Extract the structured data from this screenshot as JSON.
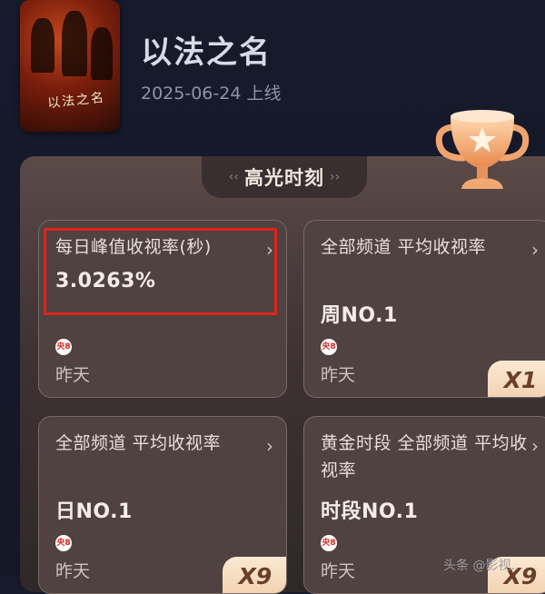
{
  "show": {
    "title": "以法之名",
    "release_date": "2025-06-24 上线",
    "poster_title": "以法之名"
  },
  "section": {
    "title": "高光时刻",
    "icon": "trophy-star-icon"
  },
  "cards": [
    {
      "title": "每日峰值收视率(秒)",
      "value": "3.0263%",
      "channel_logo": "央8",
      "time": "昨天",
      "multiplier": ""
    },
    {
      "title": "全部频道 平均收视率",
      "value": "周NO.1",
      "channel_logo": "央8",
      "time": "昨天",
      "multiplier": "X1"
    },
    {
      "title": "全部频道 平均收视率",
      "value": "日NO.1",
      "channel_logo": "央8",
      "time": "昨天",
      "multiplier": "X9"
    },
    {
      "title": "黄金时段 全部频道 平均收视率",
      "value": "时段NO.1",
      "channel_logo": "央8",
      "time": "昨天",
      "multiplier": "X9"
    }
  ],
  "watermark": "头条 @影视..."
}
